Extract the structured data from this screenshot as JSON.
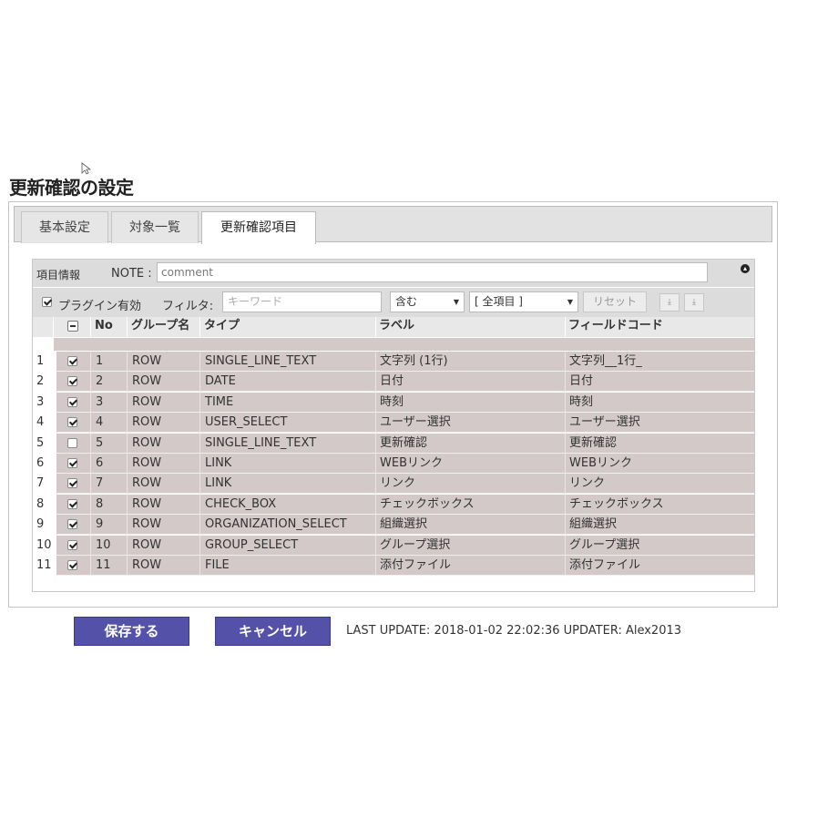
{
  "page": {
    "title": "更新確認の設定"
  },
  "tabs": [
    {
      "label": "基本設定",
      "active": false
    },
    {
      "label": "対象一覧",
      "active": false
    },
    {
      "label": "更新確認項目",
      "active": true
    }
  ],
  "info": {
    "section_label": "項目情報",
    "note_label": "NOTE :",
    "note_value": "comment",
    "collapse_icon": "circle-collapse-icon"
  },
  "filter": {
    "plugin_enabled_label": "プラグイン有効",
    "plugin_enabled": true,
    "filter_label": "フィルタ:",
    "keyword_placeholder": "キーワード",
    "match_mode": "含む",
    "field_scope": "[ 全項目 ]",
    "reset_label": "リセット",
    "move_down_icon": "⤓",
    "move_bottom_icon": "⤓"
  },
  "table": {
    "headers": {
      "no": "No",
      "group": "グループ名",
      "type": "タイプ",
      "label": "ラベル",
      "code": "フィールドコード"
    },
    "rows": [
      {
        "idx": "1",
        "checked": true,
        "no": "1",
        "group": "ROW",
        "type": "SINGLE_LINE_TEXT",
        "label": "文字列 (1行)",
        "code": "文字列__1行_"
      },
      {
        "idx": "2",
        "checked": true,
        "no": "2",
        "group": "ROW",
        "type": "DATE",
        "label": "日付",
        "code": "日付"
      },
      {
        "idx": "3",
        "checked": true,
        "no": "3",
        "group": "ROW",
        "type": "TIME",
        "label": "時刻",
        "code": "時刻"
      },
      {
        "idx": "4",
        "checked": true,
        "no": "4",
        "group": "ROW",
        "type": "USER_SELECT",
        "label": "ユーザー選択",
        "code": "ユーザー選択"
      },
      {
        "idx": "5",
        "checked": false,
        "no": "5",
        "group": "ROW",
        "type": "SINGLE_LINE_TEXT",
        "label": "更新確認",
        "code": "更新確認"
      },
      {
        "idx": "6",
        "checked": true,
        "no": "6",
        "group": "ROW",
        "type": "LINK",
        "label": "WEBリンク",
        "code": "WEBリンク"
      },
      {
        "idx": "7",
        "checked": true,
        "no": "7",
        "group": "ROW",
        "type": "LINK",
        "label": "リンク",
        "code": "リンク"
      },
      {
        "idx": "8",
        "checked": true,
        "no": "8",
        "group": "ROW",
        "type": "CHECK_BOX",
        "label": "チェックボックス",
        "code": "チェックボックス"
      },
      {
        "idx": "9",
        "checked": true,
        "no": "9",
        "group": "ROW",
        "type": "ORGANIZATION_SELECT",
        "label": "組織選択",
        "code": "組織選択"
      },
      {
        "idx": "10",
        "checked": true,
        "no": "10",
        "group": "ROW",
        "type": "GROUP_SELECT",
        "label": "グループ選択",
        "code": "グループ選択"
      },
      {
        "idx": "11",
        "checked": true,
        "no": "11",
        "group": "ROW",
        "type": "FILE",
        "label": "添付ファイル",
        "code": "添付ファイル"
      }
    ]
  },
  "footer": {
    "save_label": "保存する",
    "cancel_label": "キャンセル",
    "last_update": "LAST UPDATE: 2018-01-02 22:02:36 UPDATER: Alex2013"
  },
  "colors": {
    "primary_button": "#5452a8",
    "row_bg": "#d3c9c9"
  }
}
